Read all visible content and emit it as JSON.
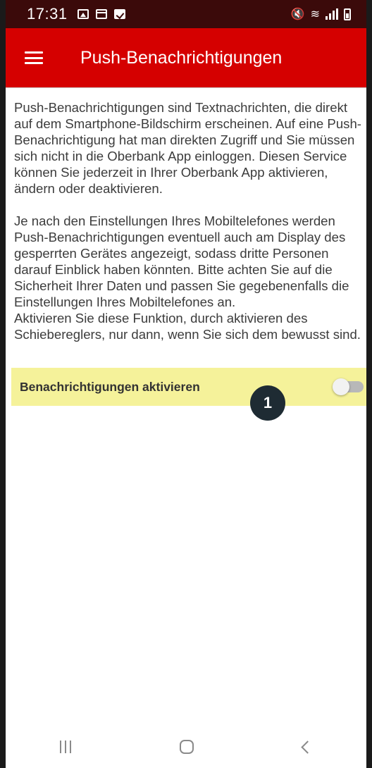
{
  "status_bar": {
    "time": "17:31"
  },
  "app_bar": {
    "title": "Push-Benachrichtigungen",
    "menu_icon": "hamburger-menu-icon"
  },
  "content": {
    "paragraph1": "Push-Benachrichtigungen sind Textnachrichten, die direkt auf dem Smartphone-Bildschirm erscheinen. Auf eine Push-Benachrichtigung hat man direkten Zugriff und Sie müssen sich nicht in die Oberbank App einloggen. Diesen Service können Sie jederzeit in Ihrer Oberbank App aktivieren, ändern oder deaktivieren.",
    "paragraph2": "Je nach den Einstellungen Ihres Mobiltelefones werden Push-Benachrichtigungen eventuell auch am Display des gesperrten Gerätes angezeigt, sodass dritte Personen darauf Einblick haben könnten. Bitte achten Sie auf die Sicherheit Ihrer Daten und passen Sie gegebenenfalls die Einstellungen Ihres Mobiltelefones an.",
    "paragraph3": "Aktivieren Sie diese Funktion, durch aktivieren des Schiebereglers, nur dann, wenn Sie sich dem bewusst sind."
  },
  "toggle": {
    "label": "Benachrichtigungen aktivieren",
    "state": "off",
    "highlight_color": "#f5f29a"
  },
  "marker": {
    "number": "1"
  },
  "colors": {
    "accent": "#d50000",
    "status_bar": "#3b0a0a"
  }
}
